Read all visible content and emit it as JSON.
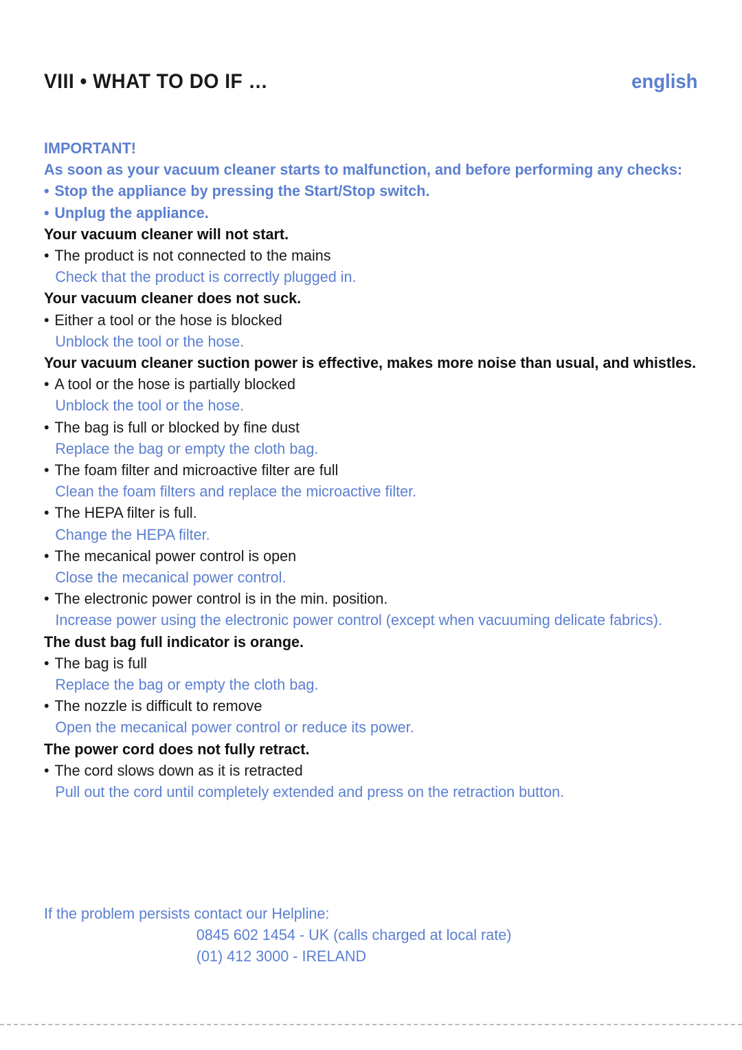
{
  "header": {
    "title": "VIII • WHAT TO DO IF …",
    "language": "english"
  },
  "colors": {
    "accent_blue": "#5b7fd0",
    "text_black": "#1a1a1a",
    "rule_gray": "#b9b9b9",
    "background": "#ffffff"
  },
  "important": {
    "label": "IMPORTANT!",
    "intro": "As soon as your vacuum cleaner starts to malfunction, and before performing any checks:",
    "bullet_char": "•",
    "items": [
      "Stop the appliance by pressing the Start/Stop switch.",
      "Unplug the appliance."
    ]
  },
  "bullet_char": "•",
  "sections": [
    {
      "heading": "Your vacuum cleaner will not start.",
      "entries": [
        {
          "cause": "The product is not connected to the mains",
          "remedy": "Check that the product is correctly plugged in."
        }
      ]
    },
    {
      "heading": "Your vacuum cleaner does not suck.",
      "entries": [
        {
          "cause": "Either a tool or the hose is blocked",
          "remedy": "Unblock the tool or the hose."
        }
      ]
    },
    {
      "heading": "Your vacuum cleaner suction power is effective, makes more noise than usual, and whistles.",
      "entries": [
        {
          "cause": "A tool or the hose is partially blocked",
          "remedy": "Unblock the tool or the hose."
        },
        {
          "cause": "The bag is full or blocked by fine dust",
          "remedy": "Replace the bag or empty the cloth bag."
        },
        {
          "cause": "The foam filter and microactive filter are full",
          "remedy": "Clean the foam filters and replace the microactive filter."
        },
        {
          "cause": "The HEPA filter is full.",
          "remedy": "Change the HEPA filter."
        },
        {
          "cause": "The mecanical power control is open",
          "remedy": "Close the mecanical power control."
        },
        {
          "cause": "The electronic power control is in the min. position.",
          "remedy": "Increase power using the electronic power control (except when vacuuming delicate fabrics)."
        }
      ]
    },
    {
      "heading": "The dust bag full indicator is orange.",
      "entries": [
        {
          "cause": "The bag is full",
          "remedy": "Replace the bag or empty the cloth bag."
        },
        {
          "cause": "The nozzle is difficult to remove",
          "remedy": "Open the mecanical power control or reduce its power."
        }
      ]
    },
    {
      "heading": "The power cord does not fully retract.",
      "entries": [
        {
          "cause": "The cord slows down as it is retracted",
          "remedy": "Pull out the cord until completely extended and press on the retraction button."
        }
      ]
    }
  ],
  "helpline": {
    "intro": "If the problem persists contact our Helpline:",
    "numbers": [
      "0845 602 1454 - UK (calls charged at local rate)",
      "(01) 412 3000 - IRELAND"
    ]
  }
}
